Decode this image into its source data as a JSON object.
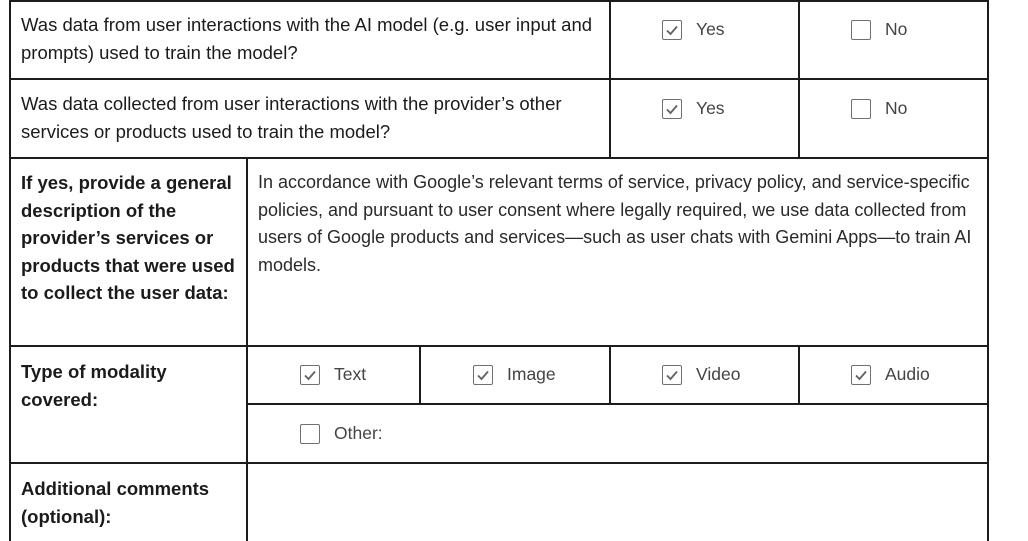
{
  "rows": {
    "interaction_data": {
      "question": "Was data from user interactions with the AI model (e.g. user input and prompts) used to train the model?",
      "options": [
        {
          "label": "Yes",
          "checked": true
        },
        {
          "label": "No",
          "checked": false
        }
      ]
    },
    "other_services": {
      "question": "Was data collected from user interactions with the provider’s other services or products used to train the model?",
      "options": [
        {
          "label": "Yes",
          "checked": true
        },
        {
          "label": "No",
          "checked": false
        }
      ]
    },
    "description": {
      "label": "If yes, provide a general description of the provider’s services or products that were used to collect the user data:",
      "text": "In accordance with Google’s relevant terms of service, privacy policy, and service-specific policies, and pursuant to user consent where legally required, we use data collected from users of Google products and services—such as user chats with Gemini Apps—to train AI models."
    },
    "modality": {
      "label": "Type of modality covered:",
      "options": [
        {
          "label": "Text",
          "checked": true
        },
        {
          "label": "Image",
          "checked": true
        },
        {
          "label": "Video",
          "checked": true
        },
        {
          "label": "Audio",
          "checked": true
        }
      ],
      "other": {
        "label": "Other:",
        "checked": false
      }
    },
    "comments": {
      "label": "Additional comments (optional):",
      "value": ""
    }
  },
  "colors": {
    "border": "#1c1c1c",
    "checkbox_border": "#707070",
    "checkmark": "#5f6368",
    "option_text": "#444444"
  }
}
